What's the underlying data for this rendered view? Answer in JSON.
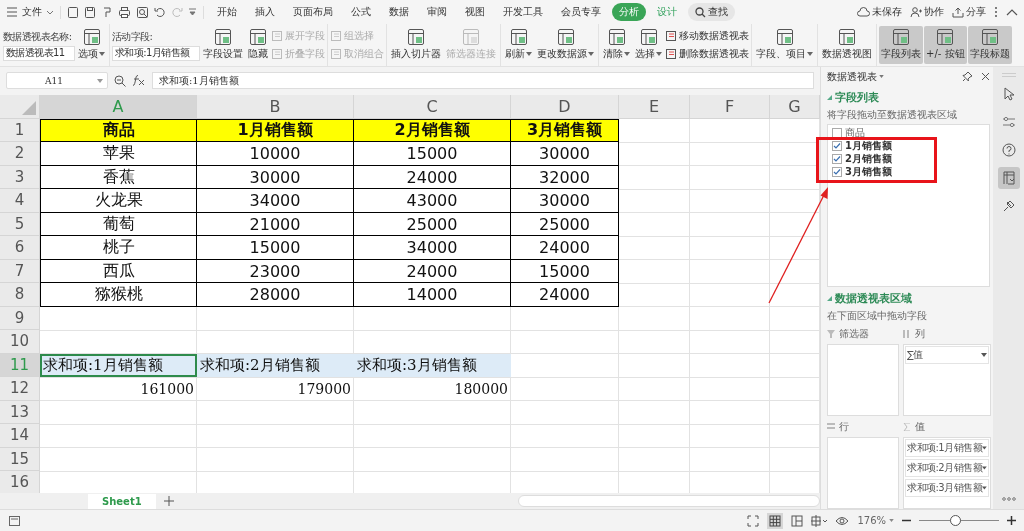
{
  "menu_bar": {
    "file": "文件",
    "tabs": [
      {
        "label": "开始",
        "selected": false,
        "contextual": false
      },
      {
        "label": "插入",
        "selected": false,
        "contextual": false
      },
      {
        "label": "页面布局",
        "selected": false,
        "contextual": false
      },
      {
        "label": "公式",
        "selected": false,
        "contextual": false
      },
      {
        "label": "数据",
        "selected": false,
        "contextual": false
      },
      {
        "label": "审阅",
        "selected": false,
        "contextual": false
      },
      {
        "label": "视图",
        "selected": false,
        "contextual": false
      },
      {
        "label": "开发工具",
        "selected": false,
        "contextual": false
      },
      {
        "label": "会员专享",
        "selected": false,
        "contextual": false
      },
      {
        "label": "分析",
        "selected": true,
        "contextual": true
      },
      {
        "label": "设计",
        "selected": false,
        "contextual": true
      }
    ],
    "search": "查找",
    "right": [
      "未保存",
      "协作",
      "分享"
    ]
  },
  "ribbon": [
    {
      "tools": [
        {
          "kind": "field",
          "label": "数据透视表名称:",
          "value": "数据透视表11"
        },
        {
          "kind": "large",
          "label": "选项",
          "dropdown": true,
          "disabled": false,
          "selected": false
        }
      ]
    },
    {
      "tools": [
        {
          "kind": "field",
          "label": "活动字段:",
          "value": "求和项:1月销售额"
        },
        {
          "kind": "large",
          "label": "字段设置",
          "dropdown": false,
          "disabled": false,
          "selected": false
        },
        {
          "kind": "large",
          "label": "隐藏",
          "dropdown": false,
          "disabled": false,
          "selected": false
        },
        {
          "kind": "stack",
          "items": [
            {
              "label": "展开字段",
              "disabled": true
            },
            {
              "label": "折叠字段",
              "disabled": true
            }
          ]
        }
      ]
    },
    {
      "tools": [
        {
          "kind": "stack",
          "items": [
            {
              "label": "组选择",
              "disabled": true
            },
            {
              "label": "取消组合",
              "disabled": true
            }
          ]
        }
      ]
    },
    {
      "tools": [
        {
          "kind": "large",
          "label": "插入切片器",
          "dropdown": false,
          "disabled": false,
          "selected": false
        },
        {
          "kind": "large",
          "label": "筛选器连接",
          "dropdown": false,
          "disabled": true,
          "selected": false
        }
      ]
    },
    {
      "tools": [
        {
          "kind": "large",
          "label": "刷新",
          "dropdown": true,
          "disabled": false,
          "selected": false
        },
        {
          "kind": "large",
          "label": "更改数据源",
          "dropdown": true,
          "disabled": false,
          "selected": false
        }
      ]
    },
    {
      "tools": [
        {
          "kind": "large",
          "label": "清除",
          "dropdown": true,
          "disabled": false,
          "selected": false
        },
        {
          "kind": "large",
          "label": "选择",
          "dropdown": true,
          "disabled": false,
          "selected": false
        },
        {
          "kind": "stack",
          "items": [
            {
              "label": "移动数据透视表",
              "disabled": false
            },
            {
              "label": "删除数据透视表",
              "disabled": false
            }
          ]
        }
      ]
    },
    {
      "tools": [
        {
          "kind": "large",
          "label": "字段、项目",
          "dropdown": true,
          "disabled": false,
          "selected": false
        }
      ]
    },
    {
      "tools": [
        {
          "kind": "large",
          "label": "数据透视图",
          "dropdown": false,
          "disabled": false,
          "selected": false
        }
      ]
    },
    {
      "tools": [
        {
          "kind": "large",
          "label": "字段列表",
          "dropdown": false,
          "disabled": false,
          "selected": true
        },
        {
          "kind": "large",
          "label": "+/- 按钮",
          "dropdown": false,
          "disabled": false,
          "selected": true
        },
        {
          "kind": "large",
          "label": "字段标题",
          "dropdown": false,
          "disabled": false,
          "selected": true
        }
      ]
    }
  ],
  "formula_bar": {
    "name_box": "A11",
    "formula": "求和项:1月销售额"
  },
  "columns": [
    {
      "label": "A",
      "selected": true
    },
    {
      "label": "B",
      "selected": false
    },
    {
      "label": "C",
      "selected": false
    },
    {
      "label": "D",
      "selected": false
    },
    {
      "label": "E",
      "selected": false
    },
    {
      "label": "F",
      "selected": false
    },
    {
      "label": "G",
      "selected": false
    }
  ],
  "rows": [
    {
      "number": "1",
      "kind": "table_header",
      "selected": false,
      "cells": [
        "商品",
        "1月销售额",
        "2月销售额",
        "3月销售额"
      ]
    },
    {
      "number": "2",
      "kind": "table",
      "selected": false,
      "cells": [
        "苹果",
        "10000",
        "15000",
        "30000"
      ]
    },
    {
      "number": "3",
      "kind": "table",
      "selected": false,
      "cells": [
        "香蕉",
        "30000",
        "24000",
        "32000"
      ]
    },
    {
      "number": "4",
      "kind": "table",
      "selected": false,
      "cells": [
        "火龙果",
        "34000",
        "43000",
        "30000"
      ]
    },
    {
      "number": "5",
      "kind": "table",
      "selected": false,
      "cells": [
        "葡萄",
        "21000",
        "25000",
        "25000"
      ]
    },
    {
      "number": "6",
      "kind": "table",
      "selected": false,
      "cells": [
        "桃子",
        "15000",
        "34000",
        "24000"
      ]
    },
    {
      "number": "7",
      "kind": "table",
      "selected": false,
      "cells": [
        "西瓜",
        "23000",
        "24000",
        "15000"
      ]
    },
    {
      "number": "8",
      "kind": "table",
      "selected": false,
      "cells": [
        "猕猴桃",
        "28000",
        "14000",
        "24000"
      ]
    },
    {
      "number": "9",
      "selected": false,
      "cells": []
    },
    {
      "number": "10",
      "selected": false,
      "cells": []
    },
    {
      "number": "11",
      "kind": "pivot_header",
      "selected": true,
      "cells": [
        "求和项:1月销售额",
        "求和项:2月销售额",
        "求和项:3月销售额"
      ]
    },
    {
      "number": "12",
      "kind": "pivot_value",
      "selected": false,
      "cells": [
        "161000",
        "179000",
        "180000"
      ]
    },
    {
      "number": "13",
      "selected": false,
      "cells": []
    },
    {
      "number": "14",
      "selected": false,
      "cells": []
    },
    {
      "number": "15",
      "selected": false,
      "cells": []
    },
    {
      "number": "16",
      "selected": false,
      "cells": []
    }
  ],
  "sheet_tabs": [
    {
      "label": "Sheet1",
      "selected": true
    }
  ],
  "pivot_panel": {
    "title": "数据透视表",
    "field_section": "字段列表",
    "field_hint": "将字段拖动至数据透视表区域",
    "fields": [
      {
        "label": "商品",
        "checked": false
      },
      {
        "label": "1月销售额",
        "checked": true
      },
      {
        "label": "2月销售额",
        "checked": true
      },
      {
        "label": "3月销售额",
        "checked": true
      }
    ],
    "area_section": "数据透视表区域",
    "area_hint": "在下面区域中拖动字段",
    "areas": [
      {
        "kind": "filter",
        "label": "筛选器"
      },
      {
        "kind": "columns",
        "label": "列",
        "items": [
          "∑值"
        ]
      },
      {
        "kind": "rows",
        "label": "行"
      },
      {
        "kind": "values",
        "label": "值",
        "items": [
          "求和项:1月销售额",
          "求和项:2月销售额",
          "求和项:3月销售额"
        ]
      }
    ]
  },
  "side_tools": [
    {
      "kind": "cursor",
      "selected": false
    },
    {
      "kind": "sliders",
      "selected": false
    },
    {
      "kind": "help",
      "selected": false
    },
    {
      "kind": "pivot",
      "selected": true
    },
    {
      "kind": "tools",
      "selected": false
    }
  ],
  "status_bar": {
    "zoom": "176%",
    "slider": {
      "level": 0.45
    }
  }
}
